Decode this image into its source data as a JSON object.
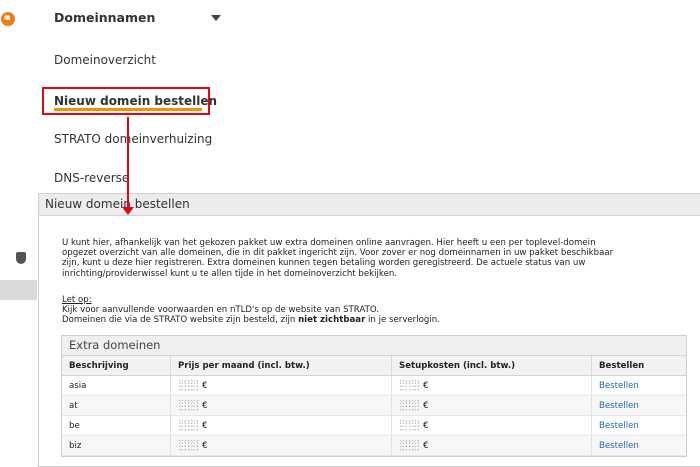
{
  "nav": {
    "section_icon": "globe-icon",
    "title": "Domeinnamen",
    "toggle_icon": "caret-down-icon",
    "items": [
      {
        "label": "Domeinoverzicht",
        "active": false
      },
      {
        "label": "Nieuw domein bestellen",
        "active": true
      },
      {
        "label": "STRATO domeinverhuizing",
        "active": false
      },
      {
        "label": "DNS-reverse",
        "active": false
      }
    ]
  },
  "colors": {
    "accent": "#f39200",
    "highlight": "#e30613",
    "link": "#2468b0"
  },
  "panel": {
    "title": "Nieuw domein bestellen",
    "intro_lines": [
      "U kunt hier, afhankelijk van het gekozen pakket uw extra domeinen online aanvragen. Hier heeft u een per toplevel-domein",
      "opgezet overzicht van alle domeinen, die in dit pakket ingericht zijn. Voor zover er nog domeinnamen in uw pakket beschikbaar",
      "zijn, kunt u deze hier registreren. Extra domeinen kunnen tegen betaling worden geregistreerd. De actuele status van uw",
      "inrichting/providerwissel kunt u te allen tijde in het domeinoverzicht bekijken."
    ],
    "note": {
      "label": "Let op:",
      "line1": "Kijk voor aanvullende voorwaarden en nTLD's op de website van STRATO.",
      "line2_before": "Domeinen die via de STRATO website zijn besteld, zijn ",
      "line2_bold": "niet zichtbaar",
      "line2_after": " in je serverlogin."
    },
    "extra": {
      "title": "Extra domeinen",
      "columns": [
        "Beschrijving",
        "Prijs per maand (incl. btw.)",
        "Setupkosten (incl. btw.)",
        "Bestellen"
      ],
      "rows": [
        {
          "tld": "asia",
          "price": "€",
          "setup": "€",
          "action": "Bestellen"
        },
        {
          "tld": "at",
          "price": "€",
          "setup": "€",
          "action": "Bestellen"
        },
        {
          "tld": "be",
          "price": "€",
          "setup": "€",
          "action": "Bestellen"
        },
        {
          "tld": "biz",
          "price": "€",
          "setup": "€",
          "action": "Bestellen"
        }
      ]
    }
  }
}
